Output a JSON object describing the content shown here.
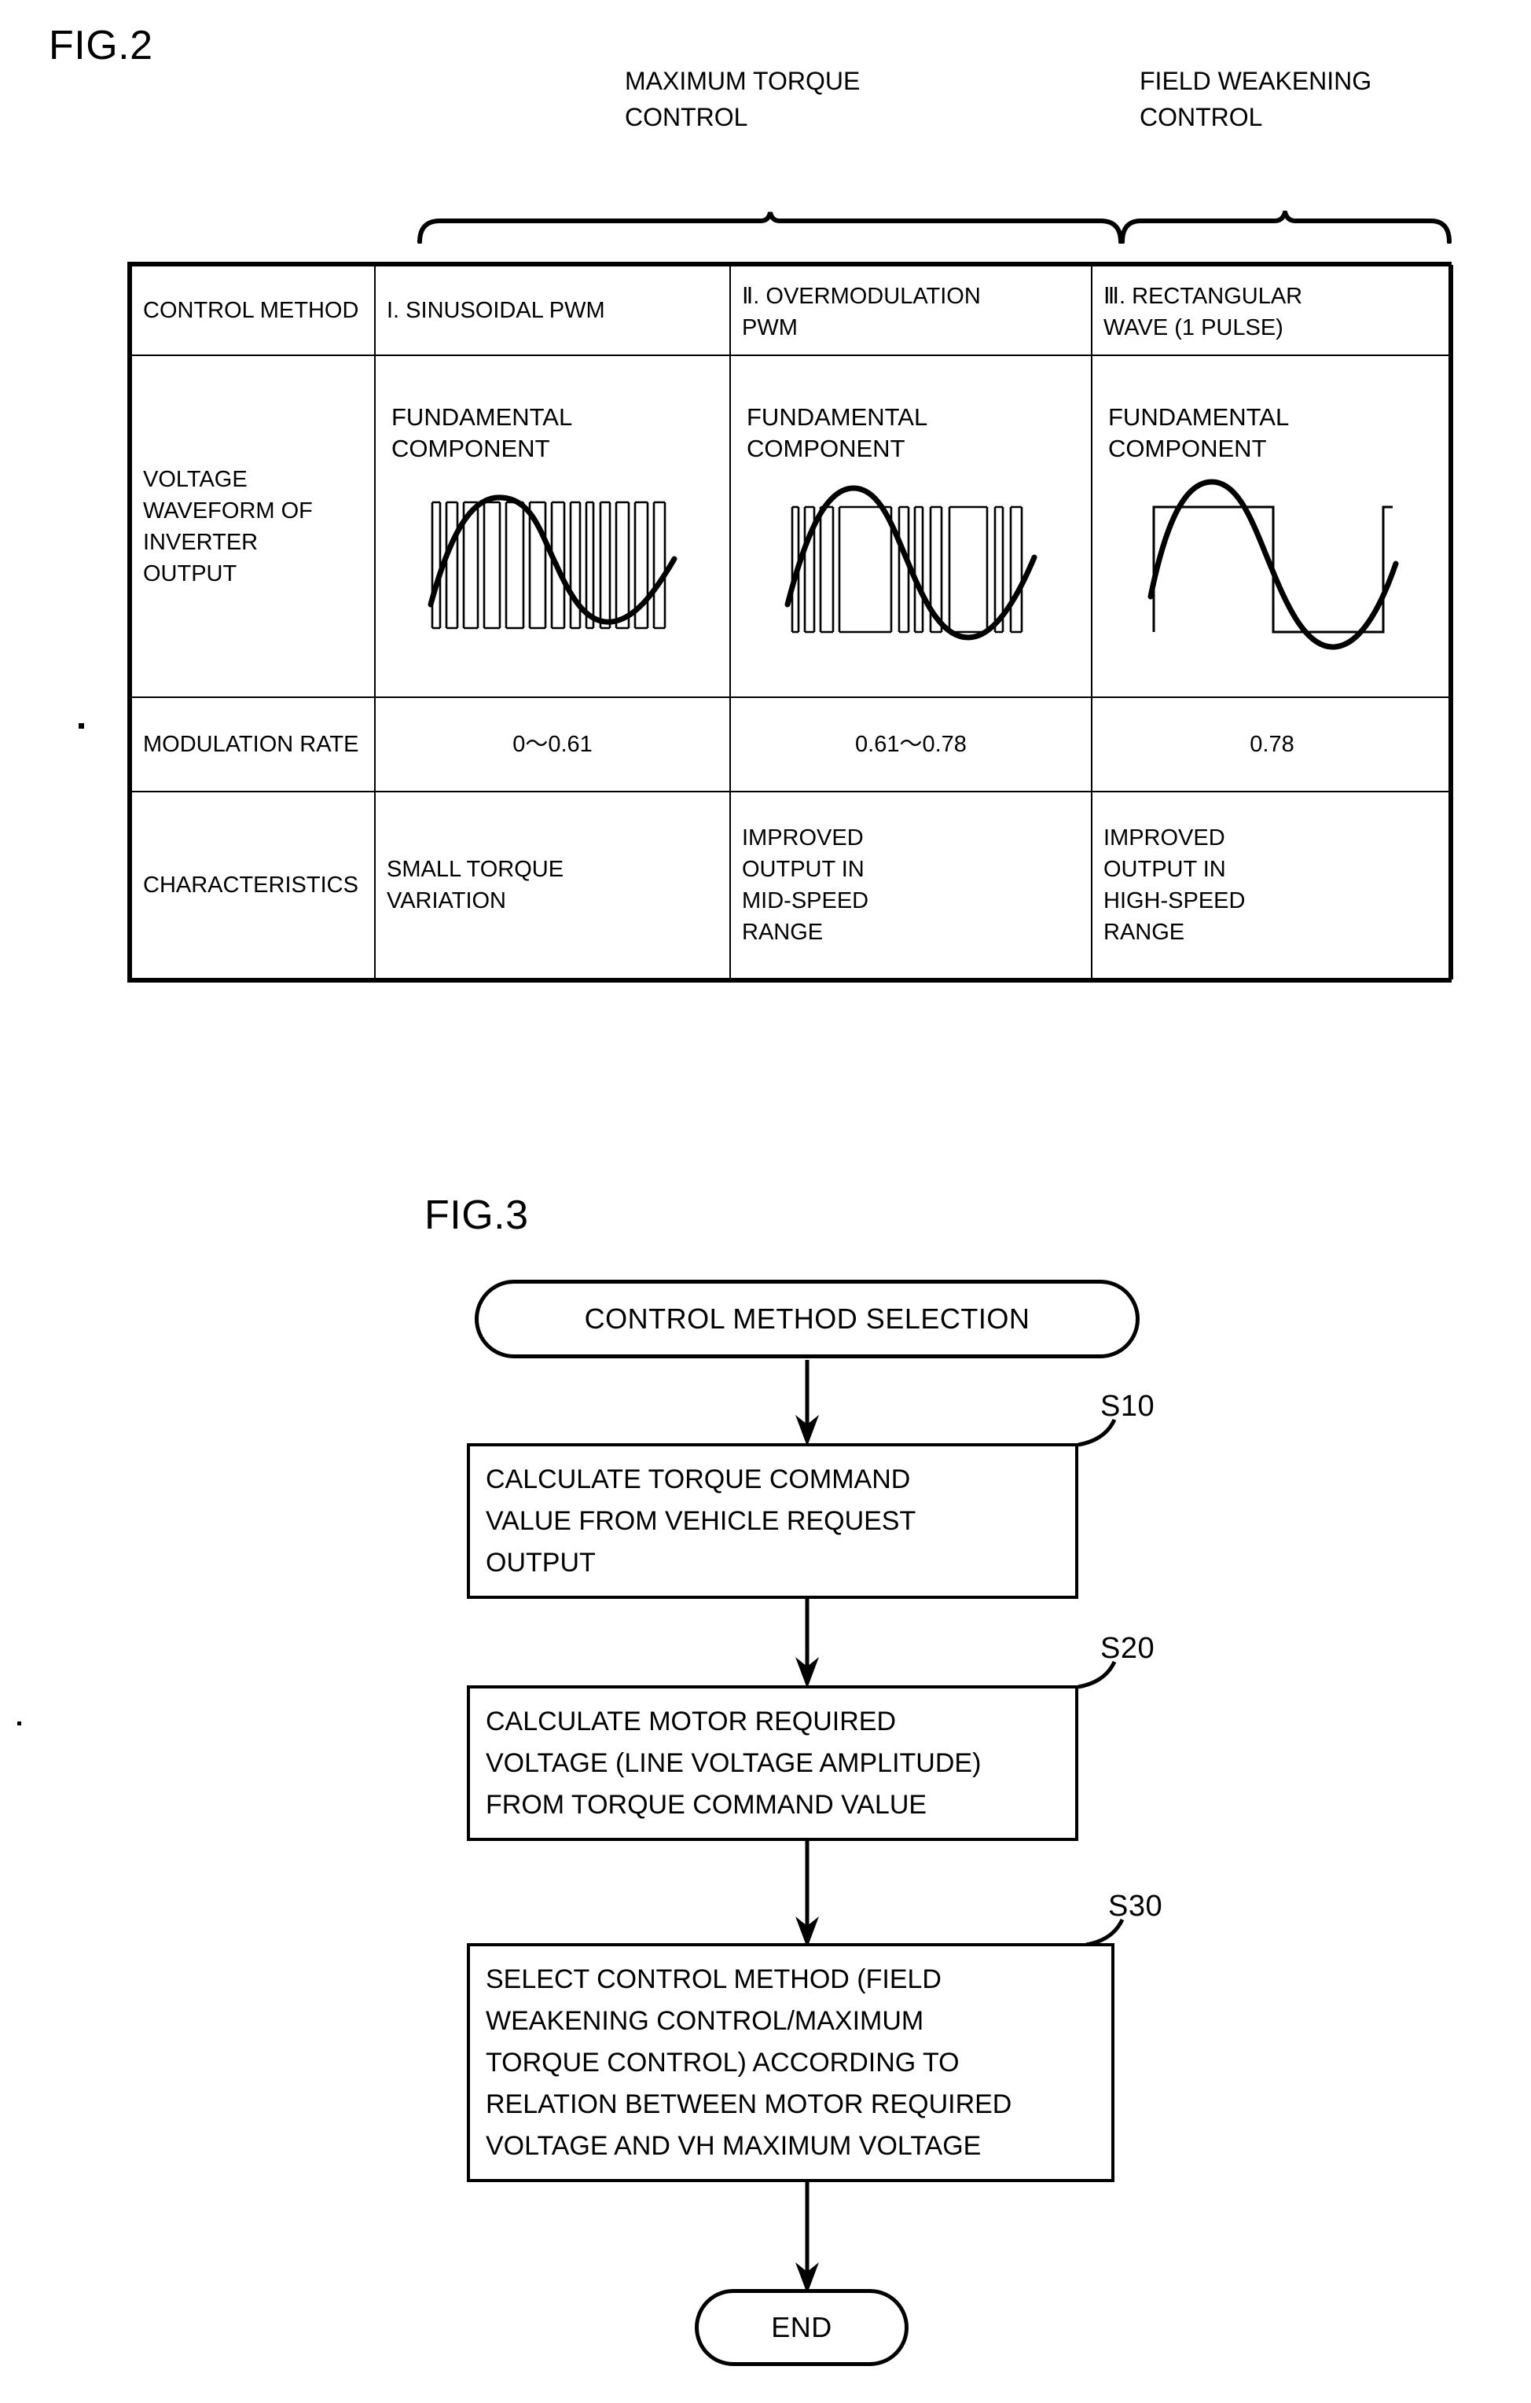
{
  "page": {
    "fig2_label": "FIG.2",
    "fig3_label": "FIG.3"
  },
  "fig2": {
    "group_headers": [
      {
        "id": "maximum-torque-control",
        "text": "MAXIMUM TORQUE\nCONTROL"
      },
      {
        "id": "field-weakening-control",
        "text": "FIELD WEAKENING\nCONTROL"
      }
    ],
    "table": {
      "header_row": {
        "row_label": "CONTROL METHOD",
        "columns": [
          {
            "numeral": "I.",
            "name": "SINUSOIDAL PWM",
            "full": "I. SINUSOIDAL PWM"
          },
          {
            "numeral": "Ⅱ.",
            "name": "OVERMODULATION\nPWM",
            "full": "Ⅱ. OVERMODULATION PWM"
          },
          {
            "numeral": "Ⅲ.",
            "name": "RECTANGULAR\nWAVE (1 PULSE)",
            "full": "Ⅲ. RECTANGULAR WAVE (1 PULSE)"
          }
        ]
      },
      "waveform_row": {
        "row_label": "VOLTAGE\nWAVEFORM OF\nINVERTER\nOUTPUT",
        "cells": [
          {
            "caption": "FUNDAMENTAL\nCOMPONENT",
            "waveform": "sinusoidal-pwm"
          },
          {
            "caption": "FUNDAMENTAL\nCOMPONENT",
            "waveform": "overmodulation-pwm"
          },
          {
            "caption": "FUNDAMENTAL\nCOMPONENT",
            "waveform": "rectangular-wave"
          }
        ]
      },
      "modulation_row": {
        "row_label": "MODULATION RATE",
        "values": [
          "0～0.61",
          "0.61～0.78",
          "0.78"
        ]
      },
      "characteristics_row": {
        "row_label": "CHARACTERISTICS",
        "values": [
          "SMALL TORQUE\nVARIATION",
          "IMPROVED\nOUTPUT IN\nMID-SPEED\nRANGE",
          "IMPROVED\nOUTPUT IN\nHIGH-SPEED\nRANGE"
        ]
      }
    }
  },
  "fig3": {
    "start_node": "CONTROL METHOD SELECTION",
    "end_node": "END",
    "steps": [
      {
        "tag": "S10",
        "text": "CALCULATE TORQUE COMMAND\nVALUE FROM VEHICLE REQUEST\nOUTPUT"
      },
      {
        "tag": "S20",
        "text": "CALCULATE MOTOR REQUIRED\nVOLTAGE (LINE VOLTAGE AMPLITUDE)\nFROM TORQUE COMMAND VALUE"
      },
      {
        "tag": "S30",
        "text": "SELECT CONTROL METHOD (FIELD\nWEAKENING CONTROL/MAXIMUM\nTORQUE CONTROL) ACCORDING TO\nRELATION BETWEEN MOTOR REQUIRED\nVOLTAGE AND VH MAXIMUM VOLTAGE"
      }
    ]
  },
  "colors": {
    "ink": "#000000",
    "paper": "#ffffff"
  }
}
